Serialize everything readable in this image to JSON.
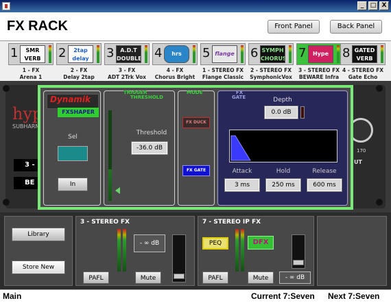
{
  "window": {
    "minimize": "_",
    "maximize": "□",
    "close": "X"
  },
  "header": {
    "title": "FX RACK",
    "front_panel": "Front Panel",
    "back_panel": "Back Panel"
  },
  "fx_slots": [
    {
      "num": "1",
      "icon_text": "SMR VERB",
      "l1": "1 - FX",
      "l2": "Arena 1"
    },
    {
      "num": "2",
      "icon_text": "2tap delay",
      "l1": "2 - FX",
      "l2": "Delay 2tap"
    },
    {
      "num": "3",
      "icon_text": "A.D.T DOUBLER",
      "l1": "3 - FX",
      "l2": "ADT 2Trk Vox"
    },
    {
      "num": "4",
      "icon_text": "hrs",
      "l1": "4 - FX",
      "l2": "Chorus Bright"
    },
    {
      "num": "5",
      "icon_text": "flange",
      "l1": "1 - STEREO FX",
      "l2": "Flange Classic"
    },
    {
      "num": "6",
      "icon_text": "SYMPH CHORUS",
      "l1": "2 - STEREO FX",
      "l2": "SymphonicVox"
    },
    {
      "num": "7",
      "icon_text": "Hype",
      "l1": "3 - STEREO FX",
      "l2": "BEWARE Infra"
    },
    {
      "num": "8",
      "icon_text": "GATED VERB",
      "l1": "4 - STEREO FX",
      "l2": "Gate Echo"
    }
  ],
  "background": {
    "logo_text": "hyp",
    "sub_text": "SUBHARM",
    "ch_a": "3 -",
    "ch_b": "BE",
    "knob_val": "170",
    "out_lbl": "UT"
  },
  "fx_panel": {
    "logo_top": "Dynamik",
    "logo_bottom": "FXSHAPER",
    "sel_label": "Sel",
    "in_button": "In",
    "trigger_label": "TRIGGER",
    "threshold_label_top": "THRESHOLD",
    "threshold_label": "Threshold",
    "threshold_value": "-36.0 dB",
    "mode_label": "MODE",
    "fx_duck": "FX DUCK",
    "fx_gate": "FX GATE",
    "gate_label_top": "FX",
    "gate_label": "GATE",
    "depth_label": "Depth",
    "depth_value": "0.0 dB",
    "attack_label": "Attack",
    "attack_value": "3 ms",
    "hold_label": "Hold",
    "hold_value": "250 ms",
    "release_label": "Release",
    "release_value": "600 ms"
  },
  "bottom": {
    "library": "Library",
    "store_new": "Store New",
    "ch1": {
      "title": "3 - STEREO FX",
      "level": "- ∞  dB",
      "pafl": "PAFL",
      "mute": "Mute"
    },
    "ch2": {
      "title": "7 - STEREO IP FX",
      "peq": "PEQ",
      "dfx": "DFX",
      "pafl": "PAFL",
      "mute": "Mute",
      "level": "- ∞ dB"
    }
  },
  "status": {
    "mode": "Main",
    "current": "Current 7:Seven",
    "next": "Next 7:Seven"
  },
  "colors": {
    "selected_slot": "#3cc23c",
    "panel_border": "#78e878",
    "gate_panel": "#27275a",
    "envelope": "#3a3aff"
  }
}
